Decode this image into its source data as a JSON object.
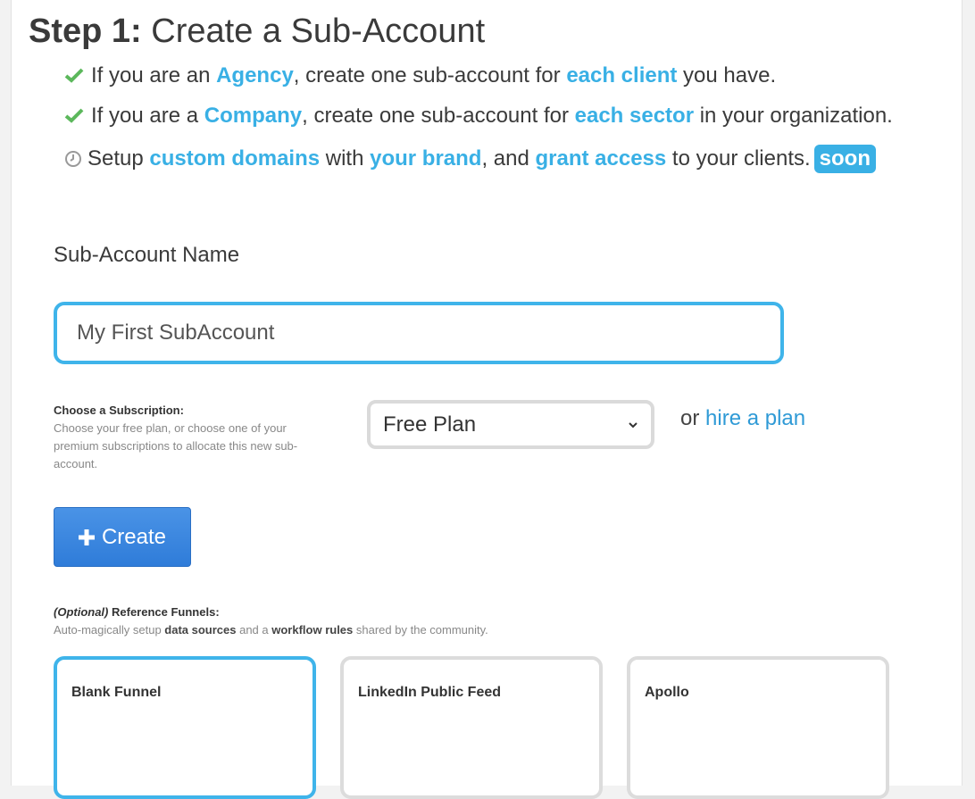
{
  "title": {
    "step": "Step 1:",
    "text": "Create a Sub-Account"
  },
  "bullets": [
    {
      "icon": "check-icon",
      "parts": [
        {
          "t": "If you are an ",
          "hl": false
        },
        {
          "t": "Agency",
          "hl": true
        },
        {
          "t": ", create one sub-account for ",
          "hl": false
        },
        {
          "t": "each client",
          "hl": true
        },
        {
          "t": " you have.",
          "hl": false
        }
      ]
    },
    {
      "icon": "check-icon",
      "parts": [
        {
          "t": "If you are a ",
          "hl": false
        },
        {
          "t": "Company",
          "hl": true
        },
        {
          "t": ", create one sub-account for ",
          "hl": false
        },
        {
          "t": "each sector",
          "hl": true
        },
        {
          "t": " in your organization.",
          "hl": false
        }
      ]
    },
    {
      "icon": "clock-icon",
      "parts": [
        {
          "t": "Setup ",
          "hl": false
        },
        {
          "t": "custom domains",
          "hl": true
        },
        {
          "t": " with ",
          "hl": false
        },
        {
          "t": "your brand",
          "hl": true
        },
        {
          "t": ", and ",
          "hl": false
        },
        {
          "t": "grant access",
          "hl": true
        },
        {
          "t": " to your clients.",
          "hl": false
        }
      ],
      "badge": "soon"
    }
  ],
  "form": {
    "name_label": "Sub-Account Name",
    "name_value": "My First SubAccount",
    "subscription_title": "Choose a Subscription:",
    "subscription_help": "Choose your free plan, or choose one of your premium subscriptions to allocate this new sub-account.",
    "plan_selected": "Free Plan",
    "or_text": "or",
    "hire_link": "hire a plan",
    "create_label": "Create"
  },
  "reference": {
    "optional": "(Optional)",
    "title": " Reference Funnels:",
    "desc_1": "Auto-magically setup ",
    "desc_b1": "data sources",
    "desc_2": " and a ",
    "desc_b2": "workflow rules",
    "desc_3": " shared by the community.",
    "cards": [
      {
        "title": "Blank Funnel",
        "selected": true
      },
      {
        "title": "LinkedIn Public Feed",
        "selected": false
      },
      {
        "title": "Apollo",
        "selected": false
      }
    ]
  },
  "colors": {
    "accent": "#39b0e5",
    "check": "#5cb85c",
    "button": "#3a85dd"
  }
}
